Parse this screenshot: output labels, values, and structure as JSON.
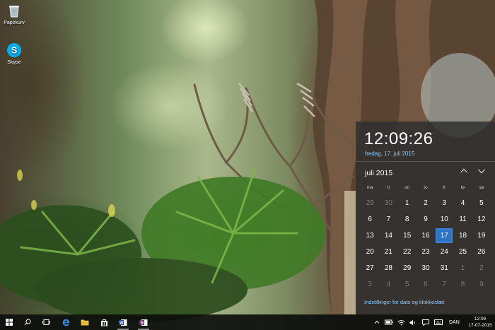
{
  "desktop": {
    "icons": [
      {
        "label": "Papirkurv",
        "icon": "recycle-bin-icon"
      },
      {
        "label": "Skype",
        "icon": "skype-icon"
      }
    ]
  },
  "calendar_flyout": {
    "time": "12:09:26",
    "full_date": "fredag, 17. juli 2015",
    "month_label": "juli 2015",
    "prev_icon": "chevron-up-icon",
    "next_icon": "chevron-down-icon",
    "weekdays": [
      "ma",
      "ti",
      "on",
      "to",
      "fr",
      "lø",
      "sø"
    ],
    "days": [
      {
        "n": "29",
        "dim": true
      },
      {
        "n": "30",
        "dim": true
      },
      {
        "n": "1"
      },
      {
        "n": "2"
      },
      {
        "n": "3"
      },
      {
        "n": "4"
      },
      {
        "n": "5"
      },
      {
        "n": "6"
      },
      {
        "n": "7"
      },
      {
        "n": "8"
      },
      {
        "n": "9"
      },
      {
        "n": "10"
      },
      {
        "n": "11"
      },
      {
        "n": "12"
      },
      {
        "n": "13"
      },
      {
        "n": "14"
      },
      {
        "n": "15"
      },
      {
        "n": "16"
      },
      {
        "n": "17",
        "today": true
      },
      {
        "n": "18"
      },
      {
        "n": "19"
      },
      {
        "n": "20"
      },
      {
        "n": "21"
      },
      {
        "n": "22"
      },
      {
        "n": "23"
      },
      {
        "n": "24"
      },
      {
        "n": "25"
      },
      {
        "n": "26"
      },
      {
        "n": "27"
      },
      {
        "n": "28"
      },
      {
        "n": "29"
      },
      {
        "n": "30"
      },
      {
        "n": "31"
      },
      {
        "n": "1",
        "dim": true
      },
      {
        "n": "2",
        "dim": true
      },
      {
        "n": "3",
        "dim": true
      },
      {
        "n": "4",
        "dim": true
      },
      {
        "n": "5",
        "dim": true
      },
      {
        "n": "6",
        "dim": true
      },
      {
        "n": "7",
        "dim": true
      },
      {
        "n": "8",
        "dim": true
      },
      {
        "n": "9",
        "dim": true
      }
    ],
    "settings_link": "Indstillinger for dato og klokkeslæt",
    "accent_color": "#2d73c4",
    "link_color": "#8ecbff"
  },
  "taskbar": {
    "buttons": [
      {
        "icon": "windows-start-icon"
      },
      {
        "icon": "search-icon"
      },
      {
        "icon": "task-view-icon"
      },
      {
        "icon": "edge-browser-icon"
      },
      {
        "icon": "file-explorer-icon"
      },
      {
        "icon": "store-icon"
      },
      {
        "icon": "word-icon"
      },
      {
        "icon": "onenote-icon"
      }
    ],
    "tray": {
      "icons": [
        "tray-expand-icon",
        "battery-icon",
        "wifi-icon",
        "volume-icon",
        "action-center-icon",
        "keyboard-icon"
      ],
      "language": "DAN",
      "time": "12:09",
      "date": "17-07-2015"
    }
  }
}
